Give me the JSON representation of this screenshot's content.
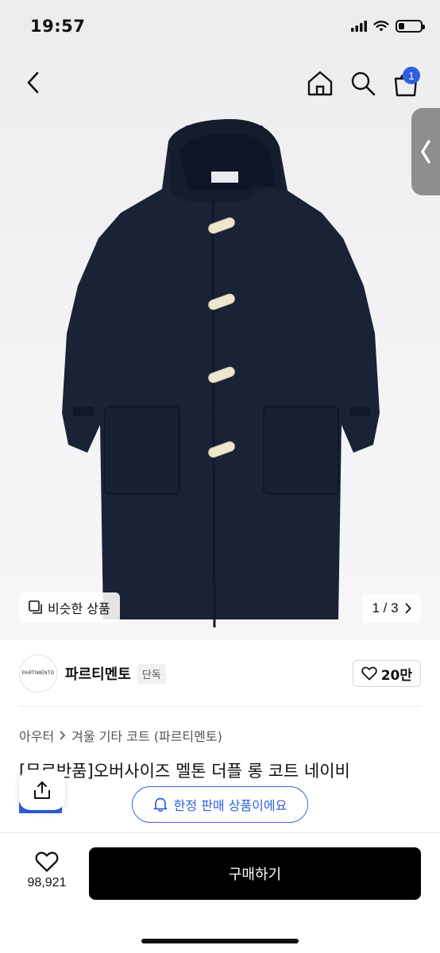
{
  "status_bar": {
    "time": "19:57",
    "battery_level": 0.25
  },
  "nav": {
    "cart_count": "1"
  },
  "image": {
    "similar_label": "비슷한 상품",
    "page_indicator": "1 / 3"
  },
  "brand": {
    "logo_text": "PARTIMENTO",
    "name": "파르티멘토",
    "tag": "단독",
    "likes": "20만"
  },
  "breadcrumb": {
    "level1": "아우터",
    "level2": "겨울 기타 코트 (파르티멘토)"
  },
  "product": {
    "title": "[무료반품]오버사이즈 멜톤 더플 롱 코트 네이비"
  },
  "notice": {
    "limited_label": "한정 판매 상품이에요"
  },
  "bottom": {
    "wish_count": "98,921",
    "buy_label": "구매하기"
  },
  "colors": {
    "accent": "#2f5fe0",
    "buy_button": "#000000",
    "coat": "#1a2236"
  }
}
